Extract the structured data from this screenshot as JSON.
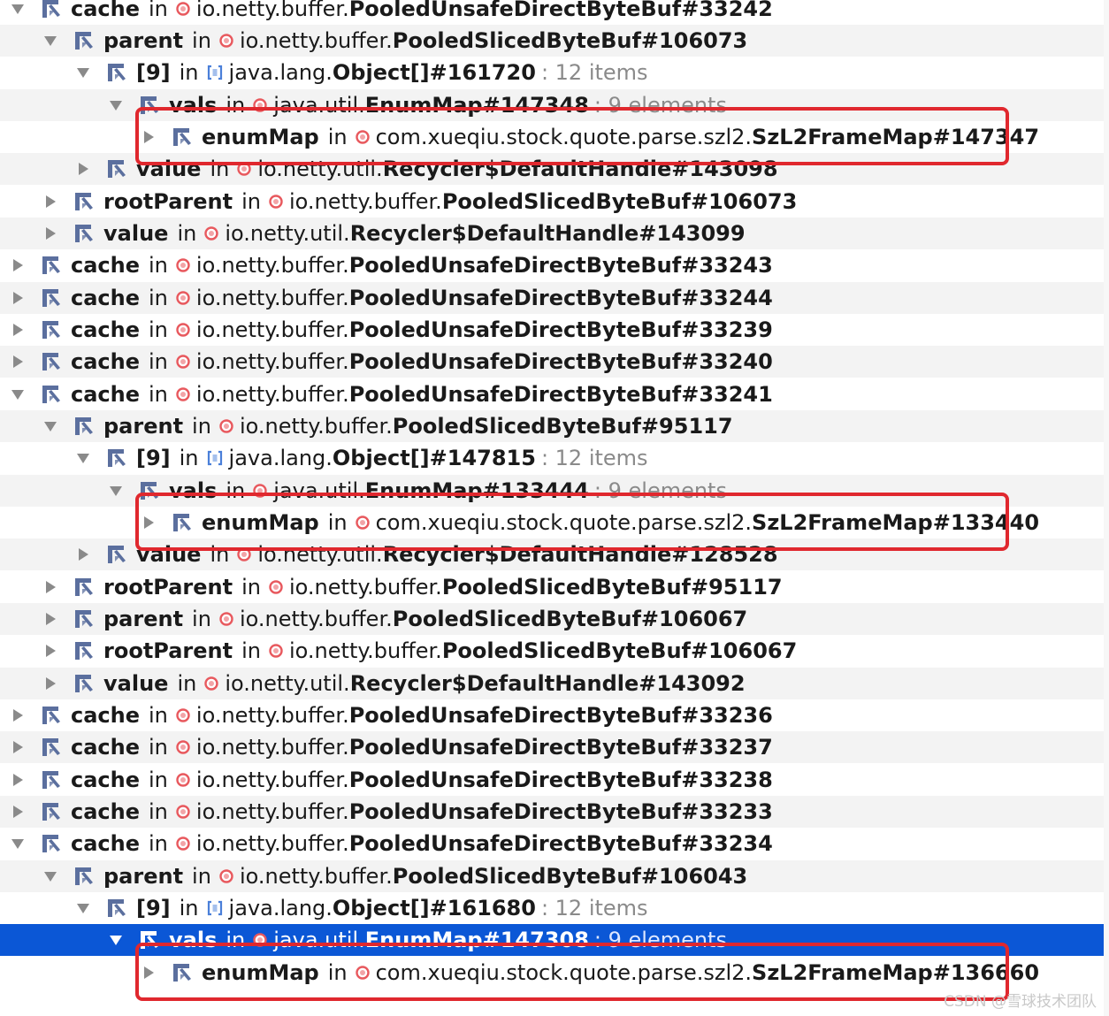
{
  "rows": [
    {
      "depth": 0,
      "expanded": true,
      "field": "cache",
      "keyword": "in",
      "icon": "object",
      "pkg": "io.netty.buffer.",
      "cls": "PooledUnsafeDirectByteBuf#33242",
      "count": ""
    },
    {
      "depth": 1,
      "expanded": true,
      "field": "parent",
      "keyword": "in",
      "icon": "object",
      "pkg": "io.netty.buffer.",
      "cls": "PooledSlicedByteBuf#106073",
      "count": ""
    },
    {
      "depth": 2,
      "expanded": true,
      "field": "[9]",
      "keyword": "in",
      "icon": "array",
      "pkg": "java.lang.",
      "cls": "Object[]#161720",
      "count": ": 12 items"
    },
    {
      "depth": 3,
      "expanded": true,
      "field": "vals",
      "keyword": "in",
      "icon": "object",
      "pkg": "java.util.",
      "cls": "EnumMap#147348",
      "count": ": 9 elements"
    },
    {
      "depth": 4,
      "expanded": false,
      "field": "enumMap",
      "keyword": "in",
      "icon": "object",
      "pkg": "com.xueqiu.stock.quote.parse.szl2.",
      "cls": "SzL2FrameMap#147347",
      "count": ""
    },
    {
      "depth": 2,
      "expanded": false,
      "field": "value",
      "keyword": "in",
      "icon": "object",
      "pkg": "io.netty.util.",
      "cls": "Recycler$DefaultHandle#143098",
      "count": ""
    },
    {
      "depth": 1,
      "expanded": false,
      "field": "rootParent",
      "keyword": "in",
      "icon": "object",
      "pkg": "io.netty.buffer.",
      "cls": "PooledSlicedByteBuf#106073",
      "count": ""
    },
    {
      "depth": 1,
      "expanded": false,
      "field": "value",
      "keyword": "in",
      "icon": "object",
      "pkg": "io.netty.util.",
      "cls": "Recycler$DefaultHandle#143099",
      "count": ""
    },
    {
      "depth": 0,
      "expanded": false,
      "field": "cache",
      "keyword": "in",
      "icon": "object",
      "pkg": "io.netty.buffer.",
      "cls": "PooledUnsafeDirectByteBuf#33243",
      "count": ""
    },
    {
      "depth": 0,
      "expanded": false,
      "field": "cache",
      "keyword": "in",
      "icon": "object",
      "pkg": "io.netty.buffer.",
      "cls": "PooledUnsafeDirectByteBuf#33244",
      "count": ""
    },
    {
      "depth": 0,
      "expanded": false,
      "field": "cache",
      "keyword": "in",
      "icon": "object",
      "pkg": "io.netty.buffer.",
      "cls": "PooledUnsafeDirectByteBuf#33239",
      "count": ""
    },
    {
      "depth": 0,
      "expanded": false,
      "field": "cache",
      "keyword": "in",
      "icon": "object",
      "pkg": "io.netty.buffer.",
      "cls": "PooledUnsafeDirectByteBuf#33240",
      "count": ""
    },
    {
      "depth": 0,
      "expanded": true,
      "field": "cache",
      "keyword": "in",
      "icon": "object",
      "pkg": "io.netty.buffer.",
      "cls": "PooledUnsafeDirectByteBuf#33241",
      "count": ""
    },
    {
      "depth": 1,
      "expanded": true,
      "field": "parent",
      "keyword": "in",
      "icon": "object",
      "pkg": "io.netty.buffer.",
      "cls": "PooledSlicedByteBuf#95117",
      "count": ""
    },
    {
      "depth": 2,
      "expanded": true,
      "field": "[9]",
      "keyword": "in",
      "icon": "array",
      "pkg": "java.lang.",
      "cls": "Object[]#147815",
      "count": ": 12 items"
    },
    {
      "depth": 3,
      "expanded": true,
      "field": "vals",
      "keyword": "in",
      "icon": "object",
      "pkg": "java.util.",
      "cls": "EnumMap#133444",
      "count": ": 9 elements"
    },
    {
      "depth": 4,
      "expanded": false,
      "field": "enumMap",
      "keyword": "in",
      "icon": "object",
      "pkg": "com.xueqiu.stock.quote.parse.szl2.",
      "cls": "SzL2FrameMap#133440",
      "count": ""
    },
    {
      "depth": 2,
      "expanded": false,
      "field": "value",
      "keyword": "in",
      "icon": "object",
      "pkg": "io.netty.util.",
      "cls": "Recycler$DefaultHandle#128528",
      "count": ""
    },
    {
      "depth": 1,
      "expanded": false,
      "field": "rootParent",
      "keyword": "in",
      "icon": "object",
      "pkg": "io.netty.buffer.",
      "cls": "PooledSlicedByteBuf#95117",
      "count": ""
    },
    {
      "depth": 1,
      "expanded": false,
      "field": "parent",
      "keyword": "in",
      "icon": "object",
      "pkg": "io.netty.buffer.",
      "cls": "PooledSlicedByteBuf#106067",
      "count": ""
    },
    {
      "depth": 1,
      "expanded": false,
      "field": "rootParent",
      "keyword": "in",
      "icon": "object",
      "pkg": "io.netty.buffer.",
      "cls": "PooledSlicedByteBuf#106067",
      "count": ""
    },
    {
      "depth": 1,
      "expanded": false,
      "field": "value",
      "keyword": "in",
      "icon": "object",
      "pkg": "io.netty.util.",
      "cls": "Recycler$DefaultHandle#143092",
      "count": ""
    },
    {
      "depth": 0,
      "expanded": false,
      "field": "cache",
      "keyword": "in",
      "icon": "object",
      "pkg": "io.netty.buffer.",
      "cls": "PooledUnsafeDirectByteBuf#33236",
      "count": ""
    },
    {
      "depth": 0,
      "expanded": false,
      "field": "cache",
      "keyword": "in",
      "icon": "object",
      "pkg": "io.netty.buffer.",
      "cls": "PooledUnsafeDirectByteBuf#33237",
      "count": ""
    },
    {
      "depth": 0,
      "expanded": false,
      "field": "cache",
      "keyword": "in",
      "icon": "object",
      "pkg": "io.netty.buffer.",
      "cls": "PooledUnsafeDirectByteBuf#33238",
      "count": ""
    },
    {
      "depth": 0,
      "expanded": false,
      "field": "cache",
      "keyword": "in",
      "icon": "object",
      "pkg": "io.netty.buffer.",
      "cls": "PooledUnsafeDirectByteBuf#33233",
      "count": ""
    },
    {
      "depth": 0,
      "expanded": true,
      "field": "cache",
      "keyword": "in",
      "icon": "object",
      "pkg": "io.netty.buffer.",
      "cls": "PooledUnsafeDirectByteBuf#33234",
      "count": ""
    },
    {
      "depth": 1,
      "expanded": true,
      "field": "parent",
      "keyword": "in",
      "icon": "object",
      "pkg": "io.netty.buffer.",
      "cls": "PooledSlicedByteBuf#106043",
      "count": ""
    },
    {
      "depth": 2,
      "expanded": true,
      "field": "[9]",
      "keyword": "in",
      "icon": "array",
      "pkg": "java.lang.",
      "cls": "Object[]#161680",
      "count": ": 12 items"
    },
    {
      "depth": 3,
      "expanded": true,
      "selected": true,
      "field": "vals",
      "keyword": "in",
      "icon": "object",
      "pkg": "java.util.",
      "cls": "EnumMap#147308",
      "count": ": 9 elements"
    },
    {
      "depth": 4,
      "expanded": false,
      "field": "enumMap",
      "keyword": "in",
      "icon": "object",
      "pkg": "com.xueqiu.stock.quote.parse.szl2.",
      "cls": "SzL2FrameMap#136660",
      "count": ""
    }
  ],
  "highlighted_rows": [
    4,
    16,
    30
  ],
  "watermark": "CSDN @雪球技术团队",
  "colors": {
    "selection": "#0b57d6",
    "stripe": "#f3f3f3",
    "highlight_border": "#e0282e",
    "object_dot": "#e8595e",
    "field_icon": "#5b6f9e"
  }
}
